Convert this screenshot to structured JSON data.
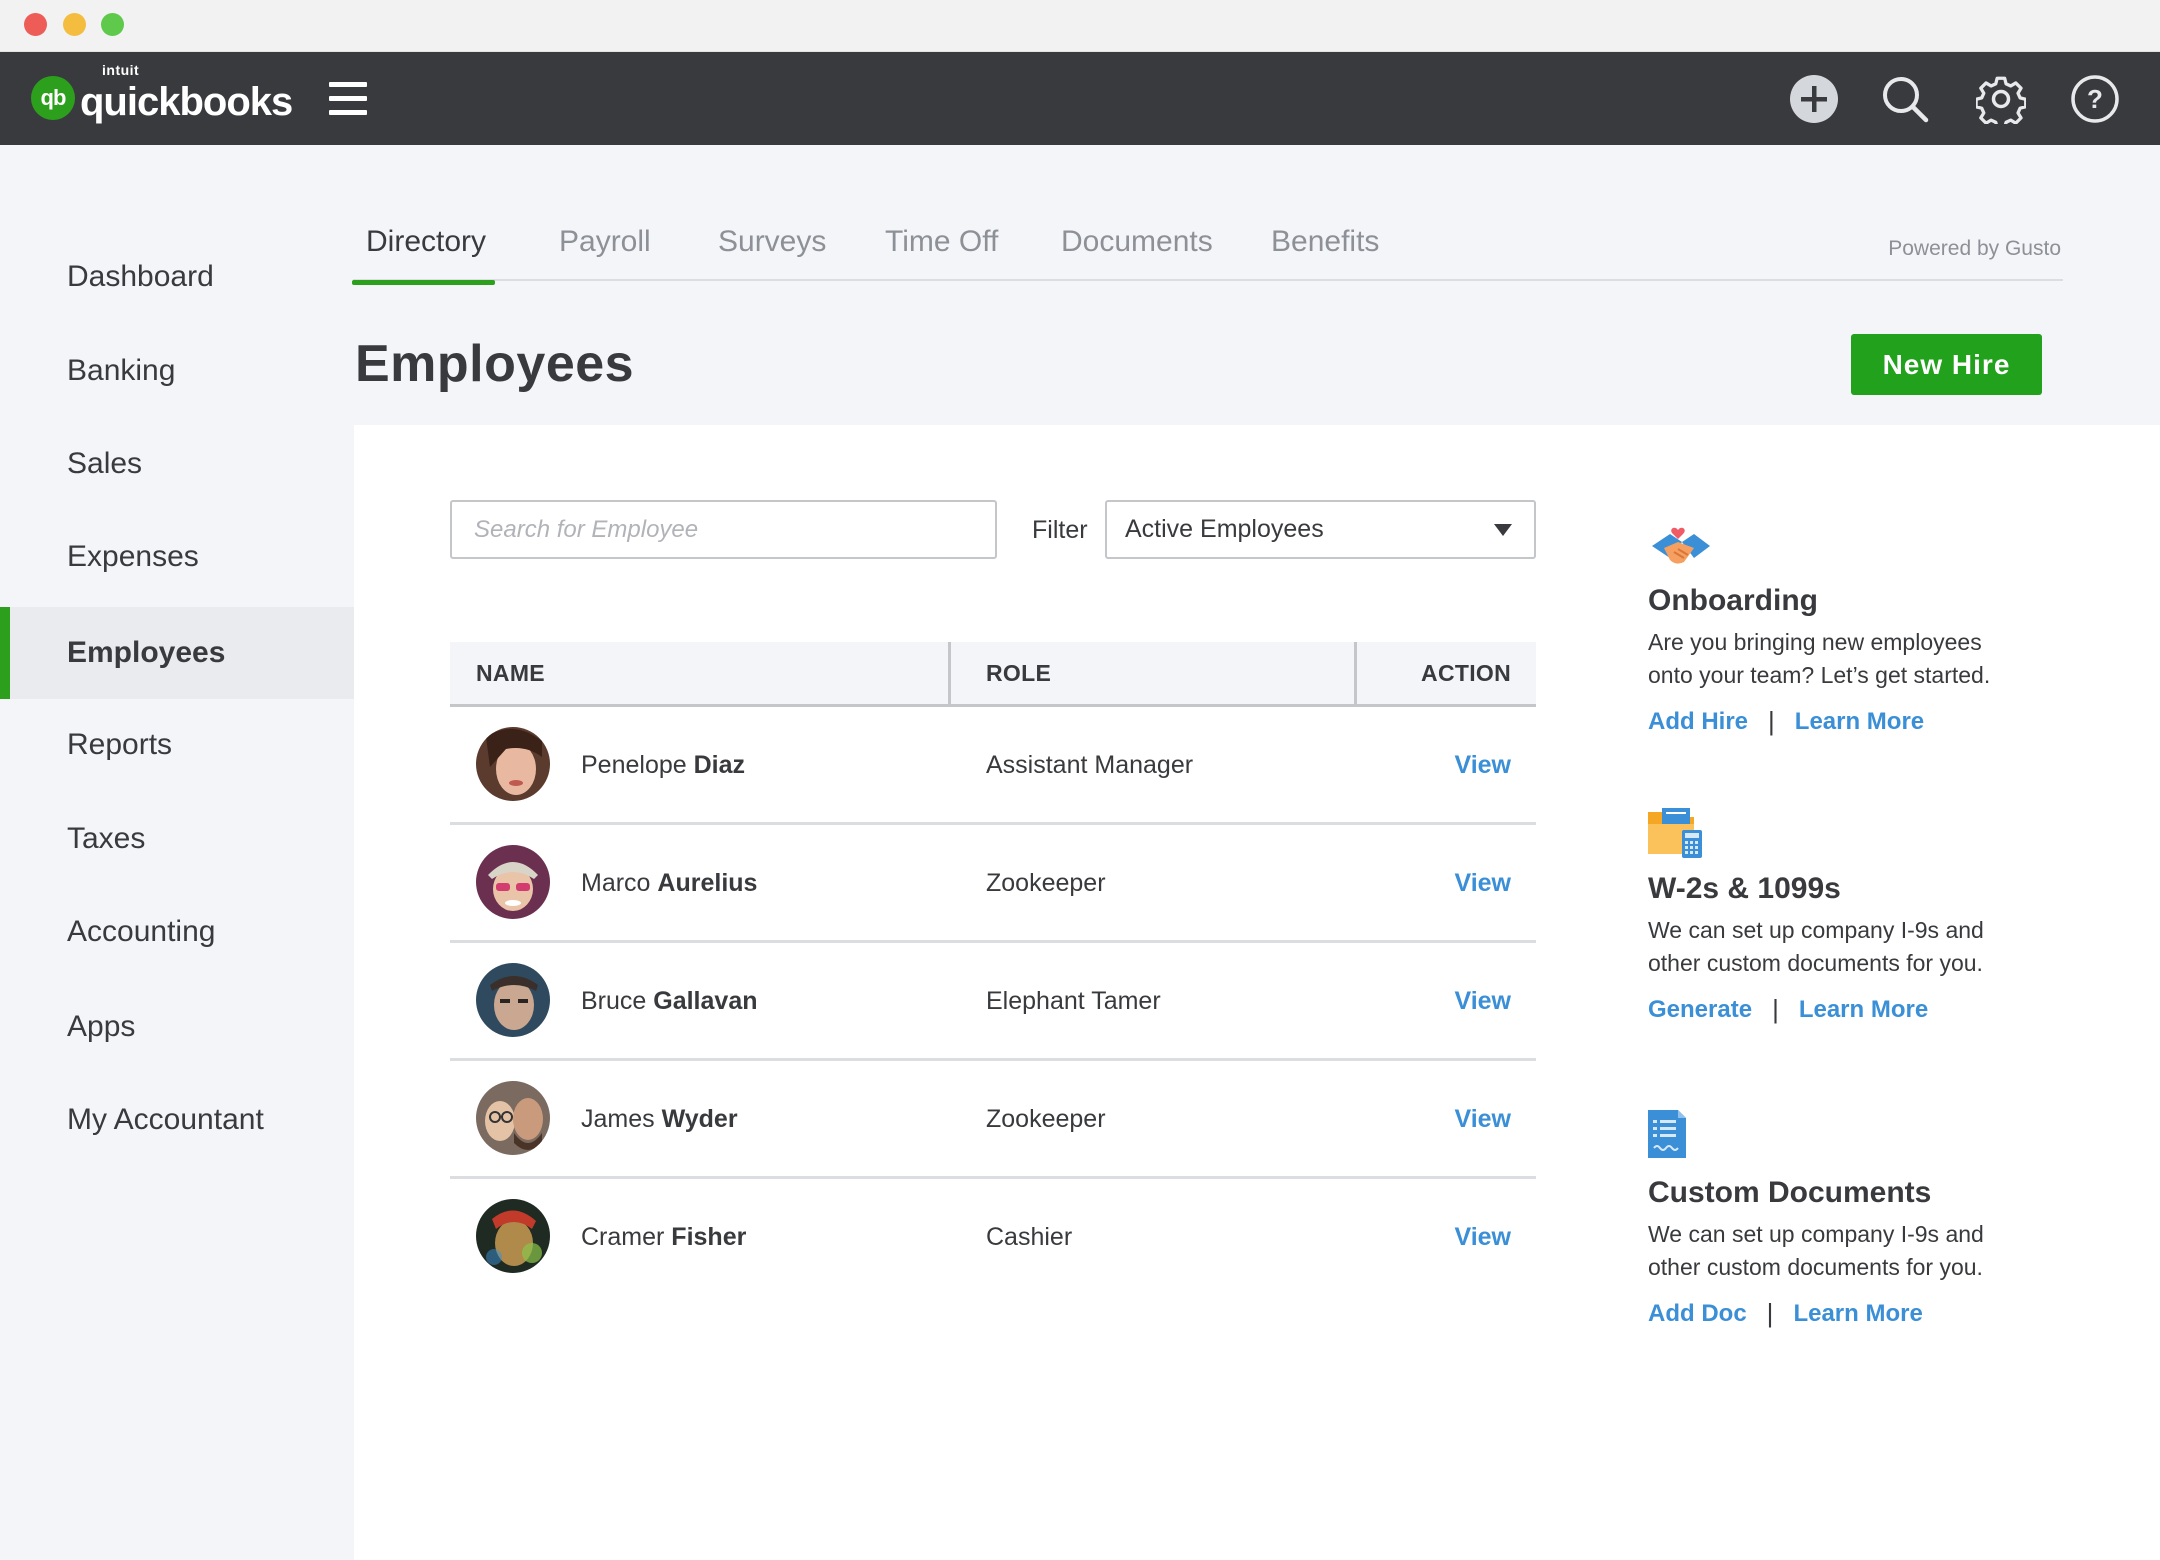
{
  "app": {
    "brand_small": "intuit",
    "brand": "quickbooks",
    "brand_mark": "qb"
  },
  "topbar": {
    "icons": [
      "plus-icon",
      "search-icon",
      "gear-icon",
      "help-icon"
    ]
  },
  "sidebar": {
    "items": [
      {
        "label": "Dashboard"
      },
      {
        "label": "Banking"
      },
      {
        "label": "Sales"
      },
      {
        "label": "Expenses"
      },
      {
        "label": "Employees",
        "active": true
      },
      {
        "label": "Reports"
      },
      {
        "label": "Taxes"
      },
      {
        "label": "Accounting"
      },
      {
        "label": "Apps"
      },
      {
        "label": "My Accountant"
      }
    ]
  },
  "tabs": {
    "items": [
      {
        "label": "Directory",
        "active": true
      },
      {
        "label": "Payroll"
      },
      {
        "label": "Surveys"
      },
      {
        "label": "Time Off"
      },
      {
        "label": "Documents"
      },
      {
        "label": "Benefits"
      }
    ],
    "powered_by": "Powered by Gusto"
  },
  "page": {
    "title": "Employees",
    "new_hire_label": "New Hire"
  },
  "search": {
    "placeholder": "Search for Employee",
    "value": ""
  },
  "filter": {
    "label": "Filter",
    "selected": "Active Employees"
  },
  "table": {
    "headers": {
      "name": "NAME",
      "role": "ROLE",
      "action": "ACTION"
    },
    "rows": [
      {
        "first": "Penelope",
        "last": "Diaz",
        "role": "Assistant Manager",
        "action": "View"
      },
      {
        "first": "Marco",
        "last": "Aurelius",
        "role": "Zookeeper",
        "action": "View"
      },
      {
        "first": "Bruce",
        "last": "Gallavan",
        "role": "Elephant Tamer",
        "action": "View"
      },
      {
        "first": "James",
        "last": "Wyder",
        "role": "Zookeeper",
        "action": "View"
      },
      {
        "first": "Cramer",
        "last": "Fisher",
        "role": "Cashier",
        "action": "View"
      }
    ]
  },
  "cards": [
    {
      "icon": "handshake-icon",
      "title": "Onboarding",
      "desc_line1": "Are you bringing new employees",
      "desc_line2": "onto your team? Let’s get started.",
      "link1": "Add Hire",
      "separator": "|",
      "link2": "Learn More"
    },
    {
      "icon": "folder-calculator-icon",
      "title": "W-2s & 1099s",
      "desc_line1": "We can set up company I-9s and",
      "desc_line2": "other custom documents for you.",
      "link1": "Generate",
      "separator": "|",
      "link2": "Learn More"
    },
    {
      "icon": "document-icon",
      "title": "Custom Documents",
      "desc_line1": "We can set up company I-9s and",
      "desc_line2": "other custom documents for you.",
      "link1": "Add Doc",
      "separator": "|",
      "link2": "Learn More"
    }
  ],
  "colors": {
    "brand_green": "#2ca01c",
    "topbar": "#393a3d",
    "link_blue": "#3a8fd6",
    "sidebar_bg": "#f4f5f8"
  }
}
